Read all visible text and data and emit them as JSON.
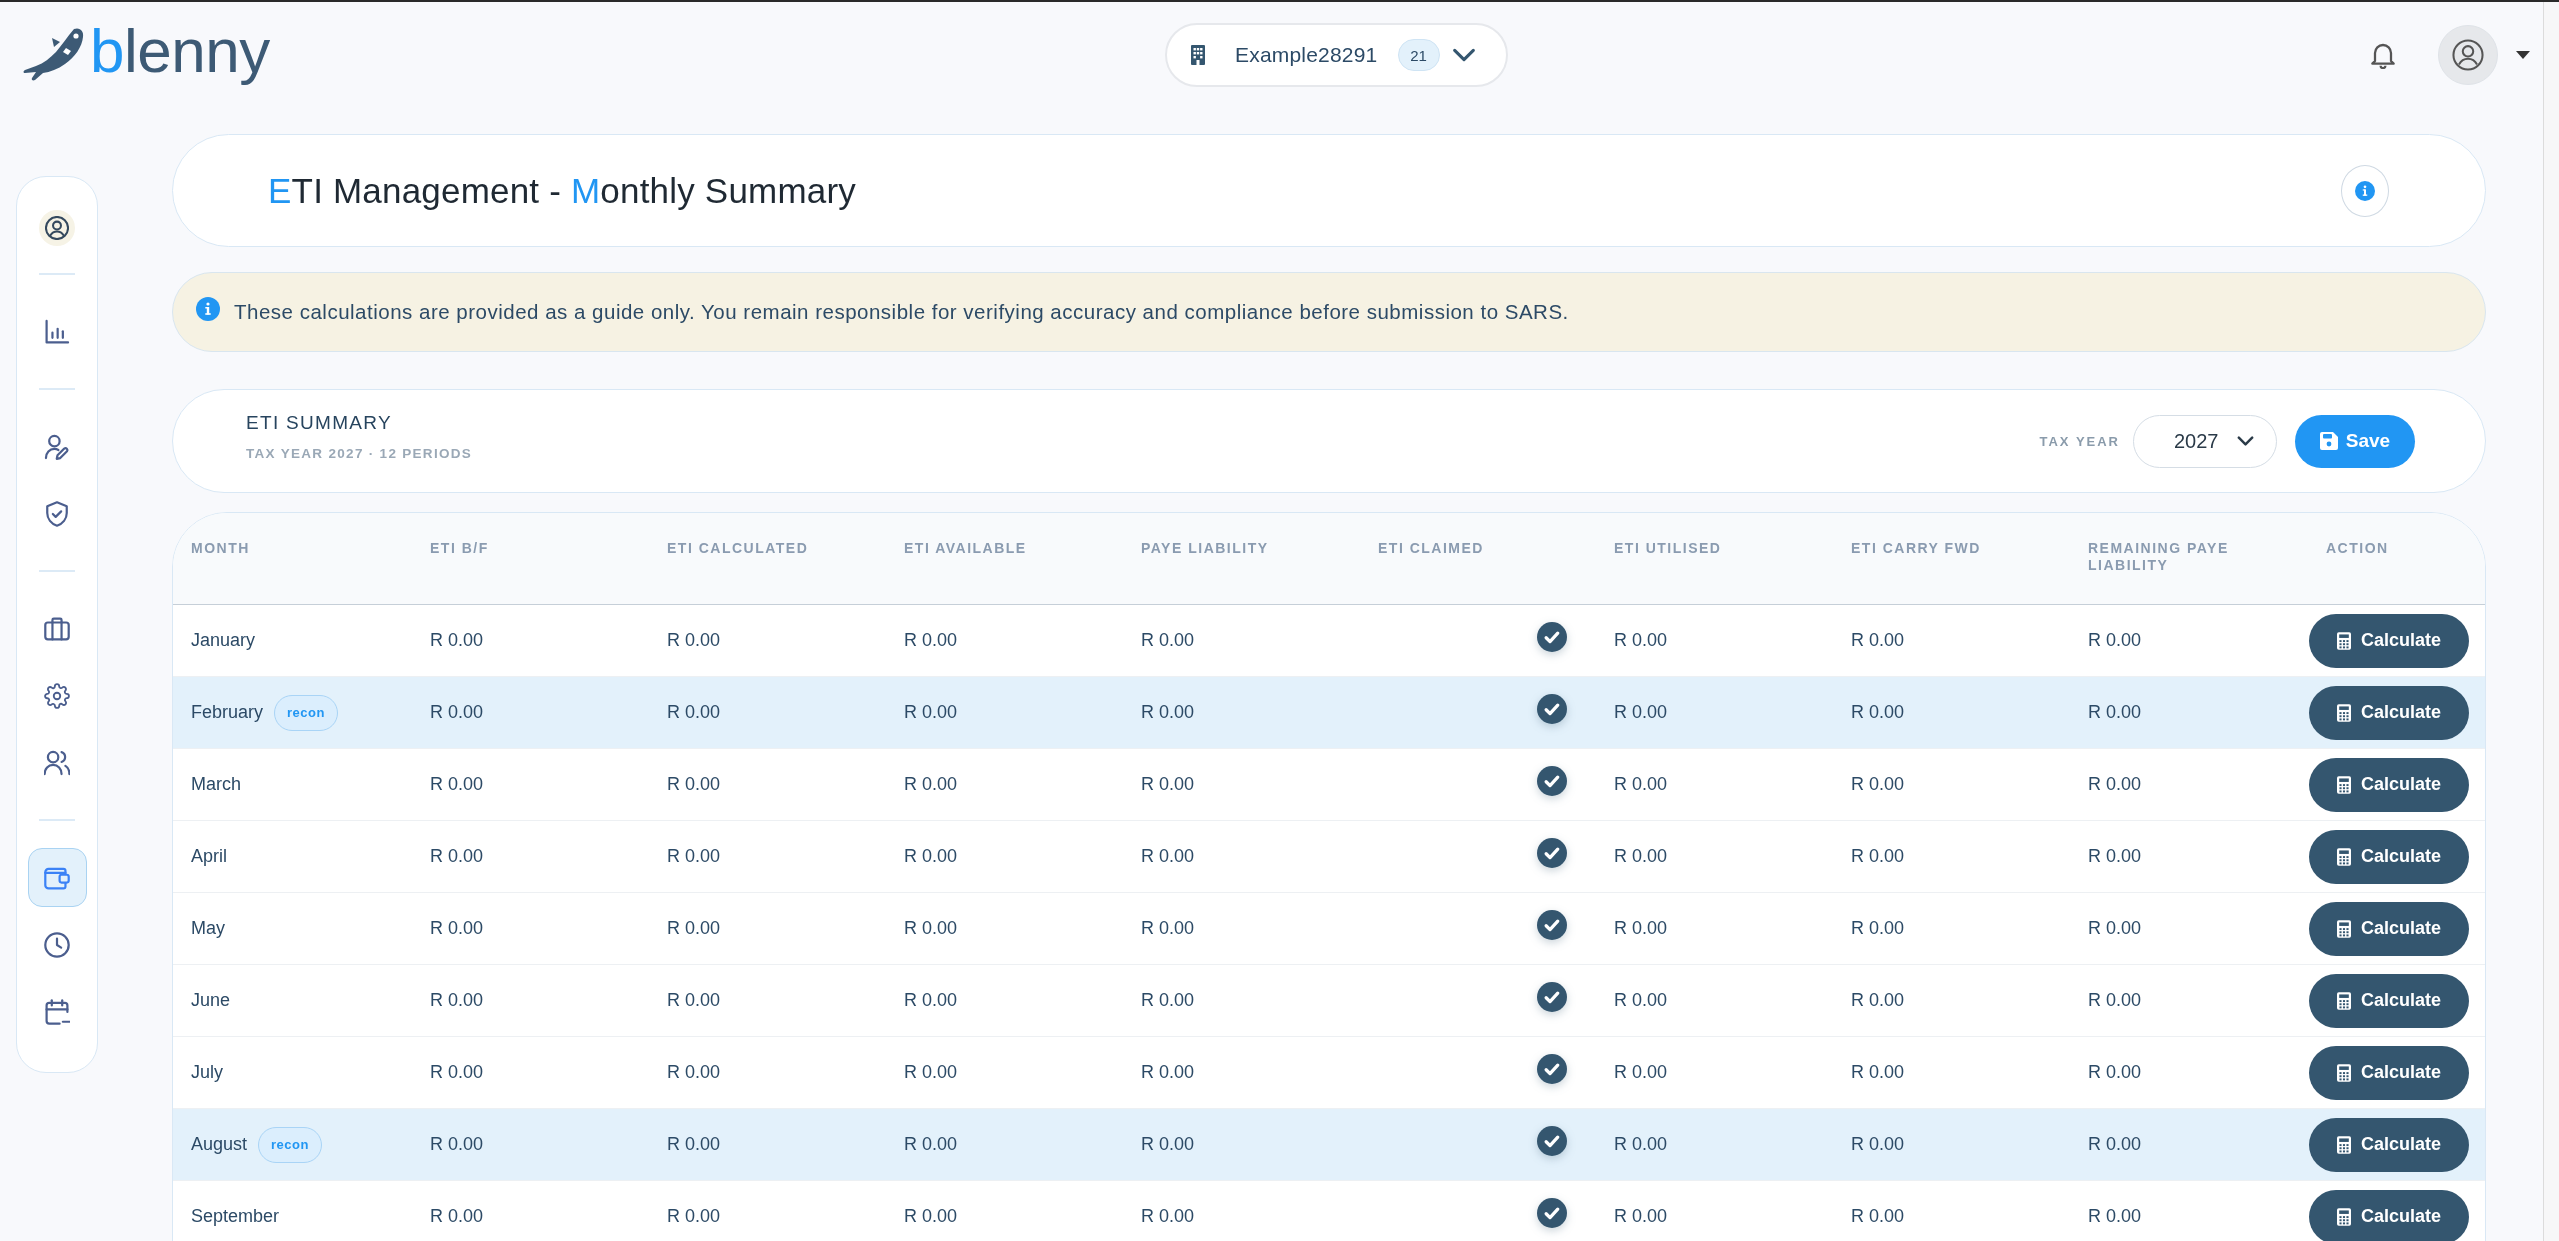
{
  "header": {
    "logo": [
      {
        "text": "b",
        "accent": true
      },
      {
        "text": "lenny",
        "accent": false
      }
    ],
    "organization": {
      "name": "Example28291",
      "count": "21"
    }
  },
  "sidebar": {
    "groups": [
      [
        {
          "selected": false
        }
      ],
      [
        {
          "selected": false
        }
      ],
      [
        {
          "selected": false
        },
        {
          "selected": false
        }
      ],
      [
        {
          "selected": false
        },
        {
          "selected": false
        },
        {
          "selected": false
        }
      ],
      [
        {
          "selected": true
        },
        {
          "selected": false
        },
        {
          "selected": false
        }
      ]
    ]
  },
  "page_title": [
    {
      "text": "E",
      "accent": true
    },
    {
      "text": "TI Management - ",
      "accent": false
    },
    {
      "text": "M",
      "accent": true
    },
    {
      "text": "onthly Summary",
      "accent": false
    }
  ],
  "notice": "These calculations are provided as a guide only. You remain responsible for verifying accuracy and compliance before submission to SARS.",
  "summary": {
    "title": "ETI SUMMARY",
    "subtitle": "TAX YEAR 2027 · 12 PERIODS",
    "tax_year": {
      "label": "TAX YEAR",
      "value": "2027"
    },
    "save_button": "Save"
  },
  "table": {
    "columns": [
      "MONTH",
      "ETI B/F",
      "ETI CALCULATED",
      "ETI AVAILABLE",
      "PAYE LIABILITY",
      "ETI CLAIMED",
      "ETI UTILISED",
      "ETI CARRY FWD",
      "REMAINING PAYE LIABILITY",
      "ACTION"
    ],
    "rows": [
      {
        "month": "January",
        "highlighted": false,
        "eti_bf": "R 0.00",
        "eti_calculated": "R 0.00",
        "eti_available": "R 0.00",
        "paye_liability": "R 0.00",
        "eti_claimed": true,
        "eti_utilised": "R 0.00",
        "eti_carry_fwd": "R 0.00",
        "remaining_paye_liability": "R 0.00",
        "action": "Calculate"
      },
      {
        "month": "February",
        "badge": "recon",
        "highlighted": true,
        "eti_bf": "R 0.00",
        "eti_calculated": "R 0.00",
        "eti_available": "R 0.00",
        "paye_liability": "R 0.00",
        "eti_claimed": true,
        "eti_utilised": "R 0.00",
        "eti_carry_fwd": "R 0.00",
        "remaining_paye_liability": "R 0.00",
        "action": "Calculate"
      },
      {
        "month": "March",
        "highlighted": false,
        "eti_bf": "R 0.00",
        "eti_calculated": "R 0.00",
        "eti_available": "R 0.00",
        "paye_liability": "R 0.00",
        "eti_claimed": true,
        "eti_utilised": "R 0.00",
        "eti_carry_fwd": "R 0.00",
        "remaining_paye_liability": "R 0.00",
        "action": "Calculate"
      },
      {
        "month": "April",
        "highlighted": false,
        "eti_bf": "R 0.00",
        "eti_calculated": "R 0.00",
        "eti_available": "R 0.00",
        "paye_liability": "R 0.00",
        "eti_claimed": true,
        "eti_utilised": "R 0.00",
        "eti_carry_fwd": "R 0.00",
        "remaining_paye_liability": "R 0.00",
        "action": "Calculate"
      },
      {
        "month": "May",
        "highlighted": false,
        "eti_bf": "R 0.00",
        "eti_calculated": "R 0.00",
        "eti_available": "R 0.00",
        "paye_liability": "R 0.00",
        "eti_claimed": true,
        "eti_utilised": "R 0.00",
        "eti_carry_fwd": "R 0.00",
        "remaining_paye_liability": "R 0.00",
        "action": "Calculate"
      },
      {
        "month": "June",
        "highlighted": false,
        "eti_bf": "R 0.00",
        "eti_calculated": "R 0.00",
        "eti_available": "R 0.00",
        "paye_liability": "R 0.00",
        "eti_claimed": true,
        "eti_utilised": "R 0.00",
        "eti_carry_fwd": "R 0.00",
        "remaining_paye_liability": "R 0.00",
        "action": "Calculate"
      },
      {
        "month": "July",
        "highlighted": false,
        "eti_bf": "R 0.00",
        "eti_calculated": "R 0.00",
        "eti_available": "R 0.00",
        "paye_liability": "R 0.00",
        "eti_claimed": true,
        "eti_utilised": "R 0.00",
        "eti_carry_fwd": "R 0.00",
        "remaining_paye_liability": "R 0.00",
        "action": "Calculate"
      },
      {
        "month": "August",
        "badge": "recon",
        "highlighted": true,
        "eti_bf": "R 0.00",
        "eti_calculated": "R 0.00",
        "eti_available": "R 0.00",
        "paye_liability": "R 0.00",
        "eti_claimed": true,
        "eti_utilised": "R 0.00",
        "eti_carry_fwd": "R 0.00",
        "remaining_paye_liability": "R 0.00",
        "action": "Calculate"
      },
      {
        "month": "September",
        "highlighted": false,
        "eti_bf": "R 0.00",
        "eti_calculated": "R 0.00",
        "eti_available": "R 0.00",
        "paye_liability": "R 0.00",
        "eti_claimed": true,
        "eti_utilised": "R 0.00",
        "eti_carry_fwd": "R 0.00",
        "remaining_paye_liability": "R 0.00",
        "action": "Calculate"
      }
    ]
  }
}
